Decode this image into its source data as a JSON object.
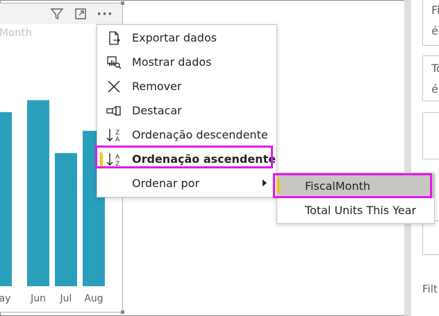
{
  "visual": {
    "title_fragment": "Month",
    "header_icons": [
      "filter-icon",
      "focus-mode-icon",
      "more-options-icon"
    ],
    "more_label": "···"
  },
  "chart_data": {
    "type": "bar",
    "categories": [
      "May",
      "Jun",
      "Jul",
      "Aug"
    ],
    "values": [
      3.35,
      3.58,
      2.56,
      2.99
    ],
    "bar_color": "#2a9fbc",
    "xlabel": "",
    "ylabel": "",
    "note": ""
  },
  "context_menu": {
    "items": [
      {
        "label": "Exportar dados",
        "icon": "export-data-icon"
      },
      {
        "label": "Mostrar dados",
        "icon": "show-data-icon"
      },
      {
        "label": "Remover",
        "icon": "remove-icon"
      },
      {
        "label": "Destacar",
        "icon": "spotlight-icon"
      },
      {
        "label": "Ordenação descendente",
        "icon": "sort-descending-icon"
      },
      {
        "label": "Ordenação ascendente",
        "icon": "sort-ascending-icon",
        "highlighted": true
      },
      {
        "label": "Ordenar por",
        "icon": "",
        "has_submenu": true
      }
    ]
  },
  "submenu": {
    "items": [
      {
        "label": "FiscalMonth",
        "selected": true
      },
      {
        "label": "Total Units This Year",
        "selected": false
      }
    ]
  },
  "right_pane": {
    "cards": [
      {
        "text": "Fi"
      },
      {
        "text": "é"
      },
      {
        "text": "To"
      },
      {
        "text": "é"
      }
    ],
    "filters_label": "Filt"
  },
  "colors": {
    "highlight_border": "#e617e6",
    "accent": "#f2c811",
    "bar": "#2a9fbc",
    "selected_bg": "#c8c6c4"
  }
}
